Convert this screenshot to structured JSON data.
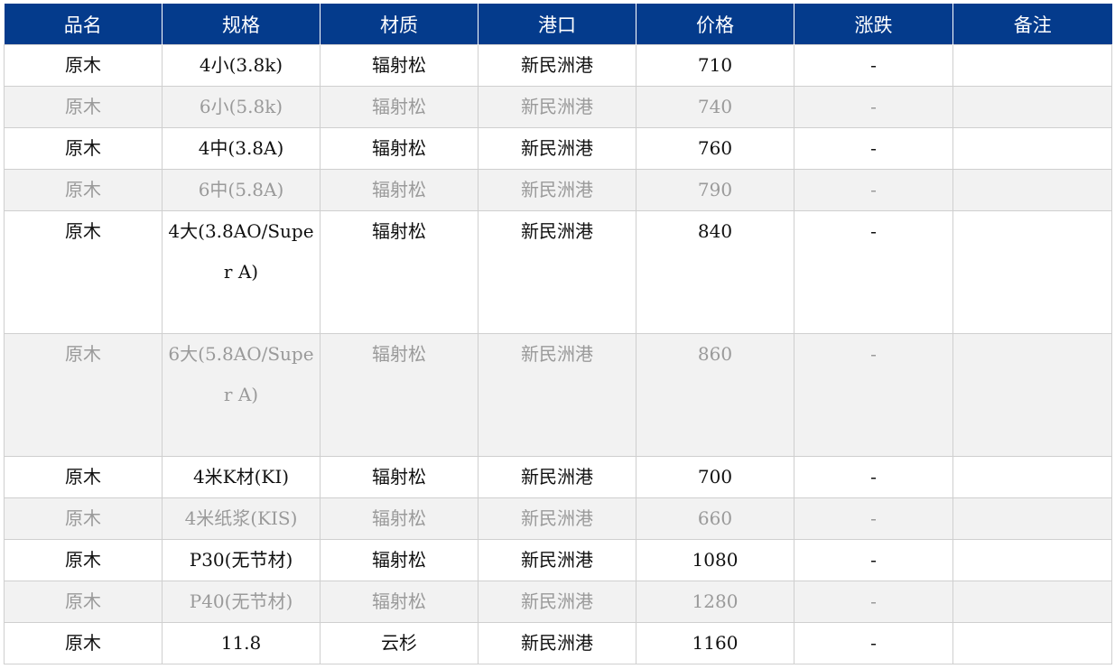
{
  "table": {
    "headers": [
      "品名",
      "规格",
      "材质",
      "港口",
      "价格",
      "涨跌",
      "备注"
    ],
    "rows": [
      [
        "原木",
        "4小(3.8k)",
        "辐射松",
        "新民洲港",
        "710",
        "-",
        ""
      ],
      [
        "原木",
        "6小(5.8k)",
        "辐射松",
        "新民洲港",
        "740",
        "-",
        ""
      ],
      [
        "原木",
        "4中(3.8A)",
        "辐射松",
        "新民洲港",
        "760",
        "-",
        ""
      ],
      [
        "原木",
        "6中(5.8A)",
        "辐射松",
        "新民洲港",
        "790",
        "-",
        ""
      ],
      [
        "原木",
        "4大(3.8AO/Super A)",
        "辐射松",
        "新民洲港",
        "840",
        "-",
        ""
      ],
      [
        "原木",
        "6大(5.8AO/Super A)",
        "辐射松",
        "新民洲港",
        "860",
        "-",
        ""
      ],
      [
        "原木",
        "4米K材(KI)",
        "辐射松",
        "新民洲港",
        "700",
        "-",
        ""
      ],
      [
        "原木",
        "4米纸浆(KIS)",
        "辐射松",
        "新民洲港",
        "660",
        "-",
        ""
      ],
      [
        "原木",
        "P30(无节材)",
        "辐射松",
        "新民洲港",
        "1080",
        "-",
        ""
      ],
      [
        "原木",
        "P40(无节材)",
        "辐射松",
        "新民洲港",
        "1280",
        "-",
        ""
      ],
      [
        "原木",
        "11.8",
        "云杉",
        "新民洲港",
        "1160",
        "-",
        ""
      ]
    ]
  },
  "colors": {
    "header_bg": "#043b8c",
    "header_text": "#ffffff",
    "alt_row_bg": "#f2f2f2",
    "alt_row_text": "#9a9a9a",
    "border": "#cfcfcf"
  }
}
